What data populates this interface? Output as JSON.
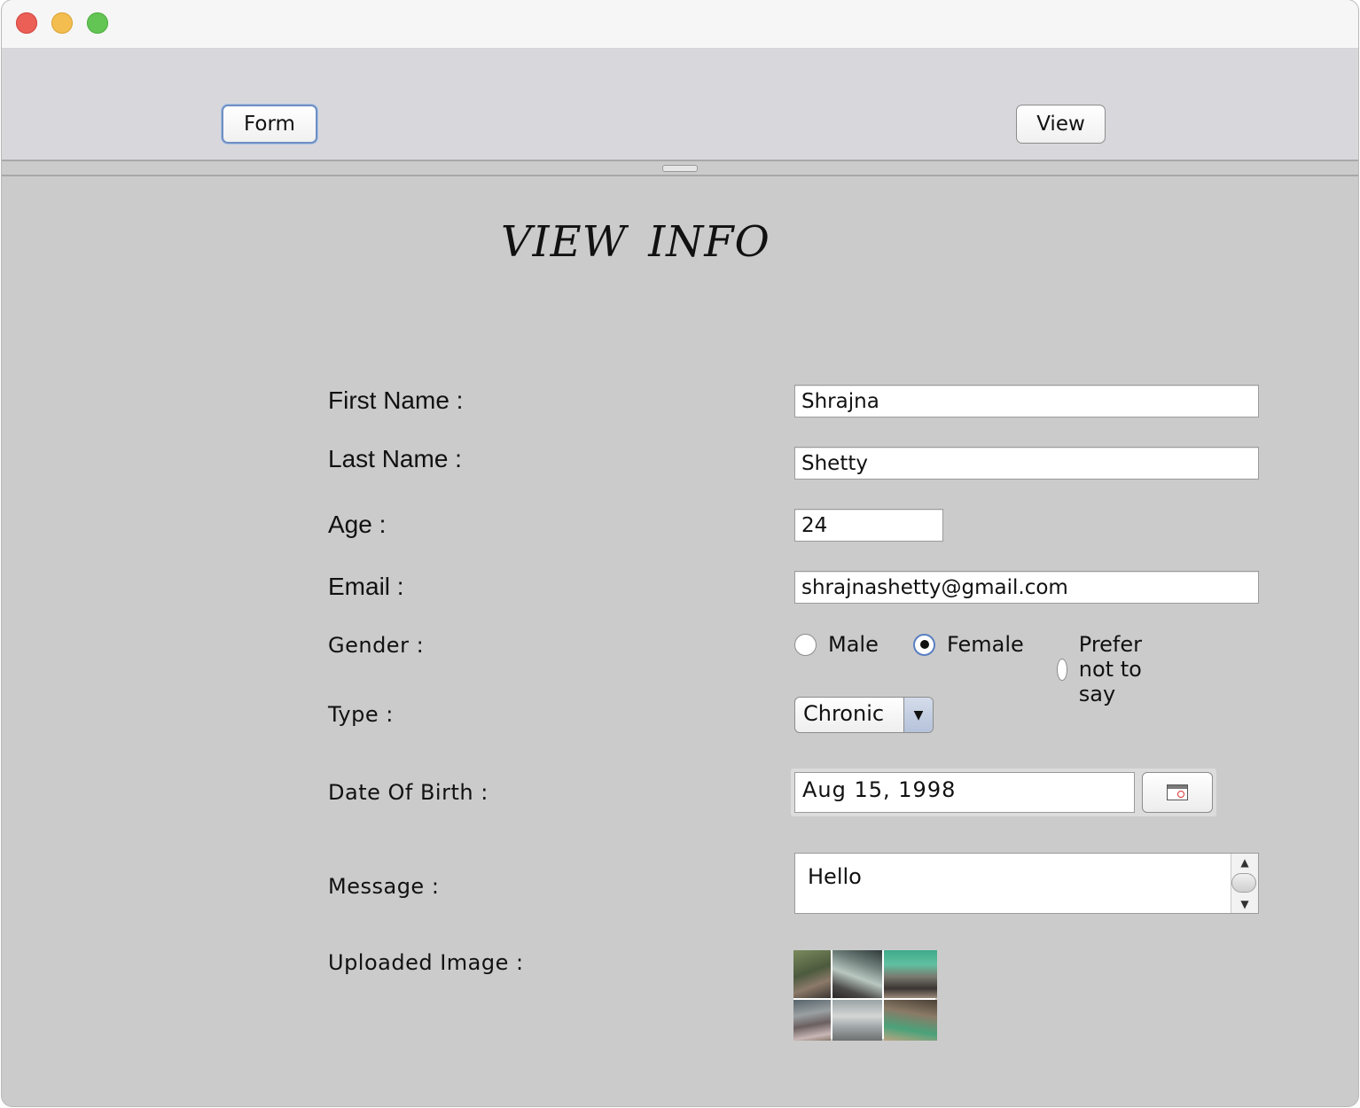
{
  "window": {
    "traffic_lights": {
      "close": "#ec5f57",
      "minimize": "#f3bd4f",
      "zoom": "#62c554"
    }
  },
  "toolbar": {
    "form_label": "Form",
    "view_label": "View"
  },
  "main": {
    "heading": "VIEW  INFO",
    "fields": {
      "first_name": {
        "label": "First Name :",
        "value": "Shrajna"
      },
      "last_name": {
        "label": "Last Name :",
        "value": "Shetty"
      },
      "age": {
        "label": "Age :",
        "value": "24"
      },
      "email": {
        "label": "Email :",
        "value": "shrajnashetty@gmail.com"
      },
      "gender": {
        "label": "Gender :",
        "options": [
          "Male",
          "Female",
          "Prefer not to say"
        ],
        "selected": "Female"
      },
      "type": {
        "label": "Type :",
        "value": "Chronic"
      },
      "dob": {
        "label": "Date Of Birth :",
        "value": "Aug 15, 1998"
      },
      "message": {
        "label": "Message :",
        "value": "Hello"
      },
      "image": {
        "label": "Uploaded Image :"
      }
    }
  },
  "icons": {
    "calendar": "calendar-icon",
    "dropdown": "chevron-down-icon",
    "scroll_up": "scroll-up-arrow-icon",
    "scroll_down": "scroll-down-arrow-icon"
  },
  "colors": {
    "window_bg": "#cbcbcb",
    "toolbar_bg": "#d8d8dc",
    "focus_ring": "#6e8fc3"
  }
}
